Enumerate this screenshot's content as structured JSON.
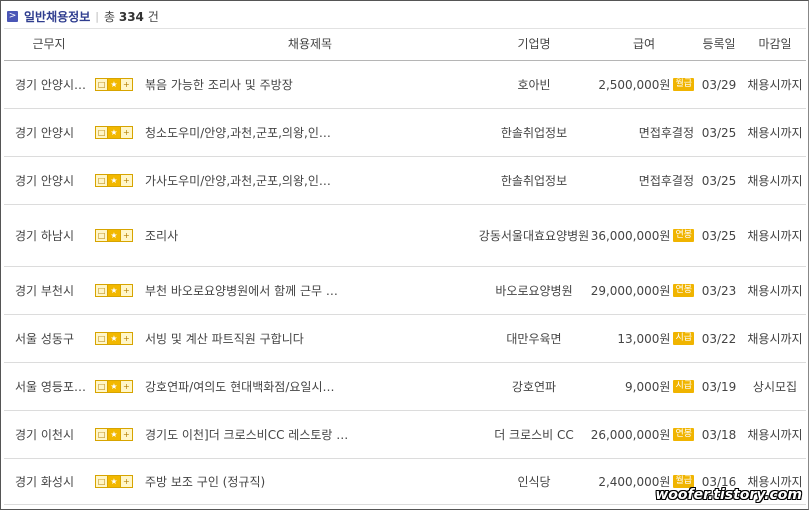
{
  "header": {
    "bullet": ">",
    "title": "일반채용정보",
    "separator": "|",
    "count_prefix": "총",
    "count_value": "334",
    "count_suffix": "건"
  },
  "columns": {
    "location": "근무지",
    "title": "채용제목",
    "company": "기업명",
    "pay": "급여",
    "posted": "등록일",
    "deadline": "마감일"
  },
  "icon_glyphs": [
    "□",
    "★",
    "+"
  ],
  "rows": [
    {
      "location": "경기 안양시…",
      "title": "볶음 가능한 조리사 및 주방장",
      "company": "호아빈",
      "pay": "2,500,000원",
      "pay_tag": "월급",
      "posted": "03/29",
      "deadline": "채용시까지"
    },
    {
      "location": "경기 안양시",
      "title": "청소도우미/안양,과천,군포,의왕,인…",
      "company": "한솔취업정보",
      "pay": "면접후결정",
      "pay_tag": "",
      "posted": "03/25",
      "deadline": "채용시까지"
    },
    {
      "location": "경기 안양시",
      "title": "가사도우미/안양,과천,군포,의왕,인…",
      "company": "한솔취업정보",
      "pay": "면접후결정",
      "pay_tag": "",
      "posted": "03/25",
      "deadline": "채용시까지"
    },
    {
      "location": "경기 하남시",
      "title": "조리사",
      "company": "강동서울대효요양병원",
      "pay": "36,000,000원",
      "pay_tag": "연봉",
      "posted": "03/25",
      "deadline": "채용시까지"
    },
    {
      "location": "경기 부천시",
      "title": "부천 바오로요양병원에서 함께 근무 …",
      "company": "바오로요양병원",
      "pay": "29,000,000원",
      "pay_tag": "연봉",
      "posted": "03/23",
      "deadline": "채용시까지"
    },
    {
      "location": "서울 성동구",
      "title": "서빙 및 계산 파트직원 구합니다",
      "company": "대만우육면",
      "pay": "13,000원",
      "pay_tag": "시급",
      "posted": "03/22",
      "deadline": "채용시까지"
    },
    {
      "location": "서울 영등포…",
      "title": "강호연파/여의도 현대백화점/요일시…",
      "company": "강호연파",
      "pay": "9,000원",
      "pay_tag": "시급",
      "posted": "03/19",
      "deadline": "상시모집"
    },
    {
      "location": "경기 이천시",
      "title": "경기도 이천]더 크로스비CC 레스토랑 …",
      "company": "더 크로스비 CC",
      "pay": "26,000,000원",
      "pay_tag": "연봉",
      "posted": "03/18",
      "deadline": "채용시까지"
    },
    {
      "location": "경기 화성시",
      "title": "주방 보조 구인 (정규직)",
      "company": "인식당",
      "pay": "2,400,000원",
      "pay_tag": "월급",
      "posted": "03/16",
      "deadline": "채용시까지"
    }
  ],
  "watermark": "woofer.tistory.com",
  "colors": {
    "title": "#2f3d8f",
    "tag": "#f0b400",
    "bullet": "#4a56b6"
  }
}
